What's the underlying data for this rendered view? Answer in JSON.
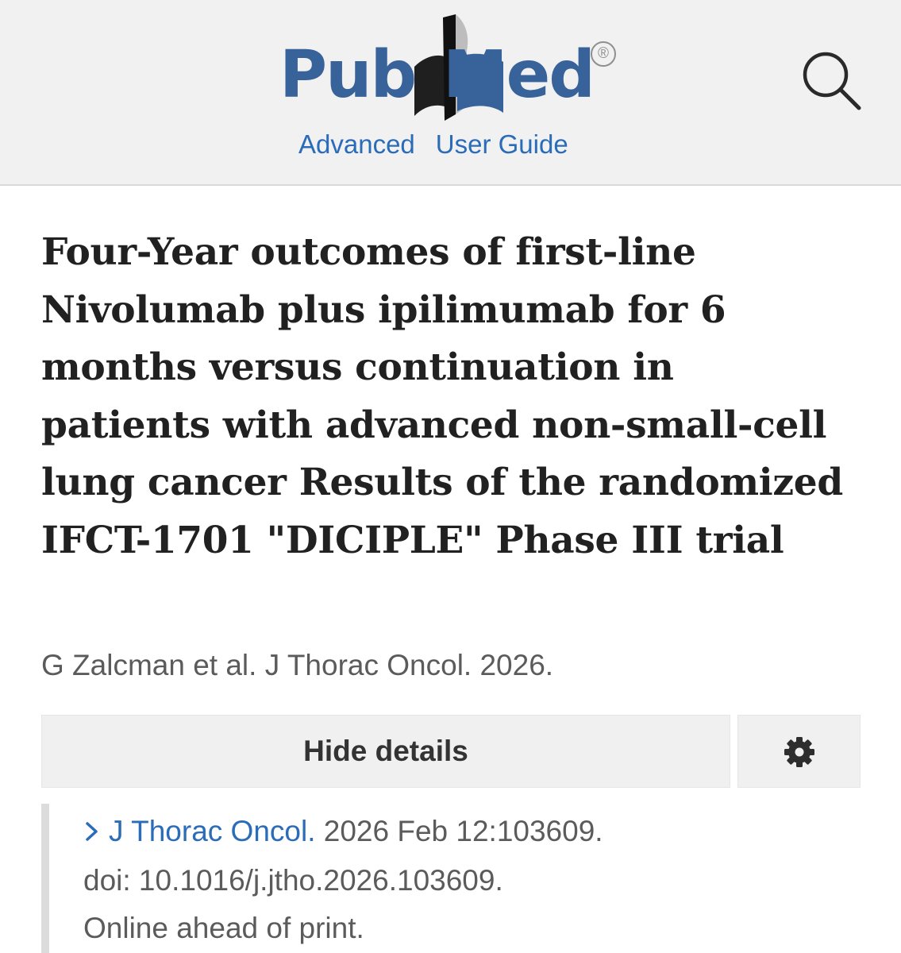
{
  "header": {
    "logo": {
      "text_pub": "Pub",
      "text_med": "Med",
      "registered_mark": "®",
      "brand_color": "#38629a"
    },
    "links": [
      {
        "label": "Advanced"
      },
      {
        "label": "User Guide"
      }
    ],
    "search_icon": "search-icon",
    "background": "#f1f1f1"
  },
  "article": {
    "title": "Four-Year outcomes of first-line Nivolumab plus ipilimumab for 6 months versus continuation in patients with advanced non-small-cell lung cancer Results of the randomized IFCT-1701 \"DICIPLE\" Phase III trial",
    "citation": "G Zalcman et al. J Thorac Oncol. 2026."
  },
  "actions": {
    "details_label": "Hide details",
    "settings_icon": "gear-icon"
  },
  "details": {
    "journal": "J Thorac Oncol.",
    "date_pages": " 2026 Feb 12:103609.",
    "doi": "doi: 10.1016/j.jtho.2026.103609.",
    "status": "Online ahead of print.",
    "expand_icon": "chevron-right-icon",
    "link_color": "#2b6cb8"
  }
}
